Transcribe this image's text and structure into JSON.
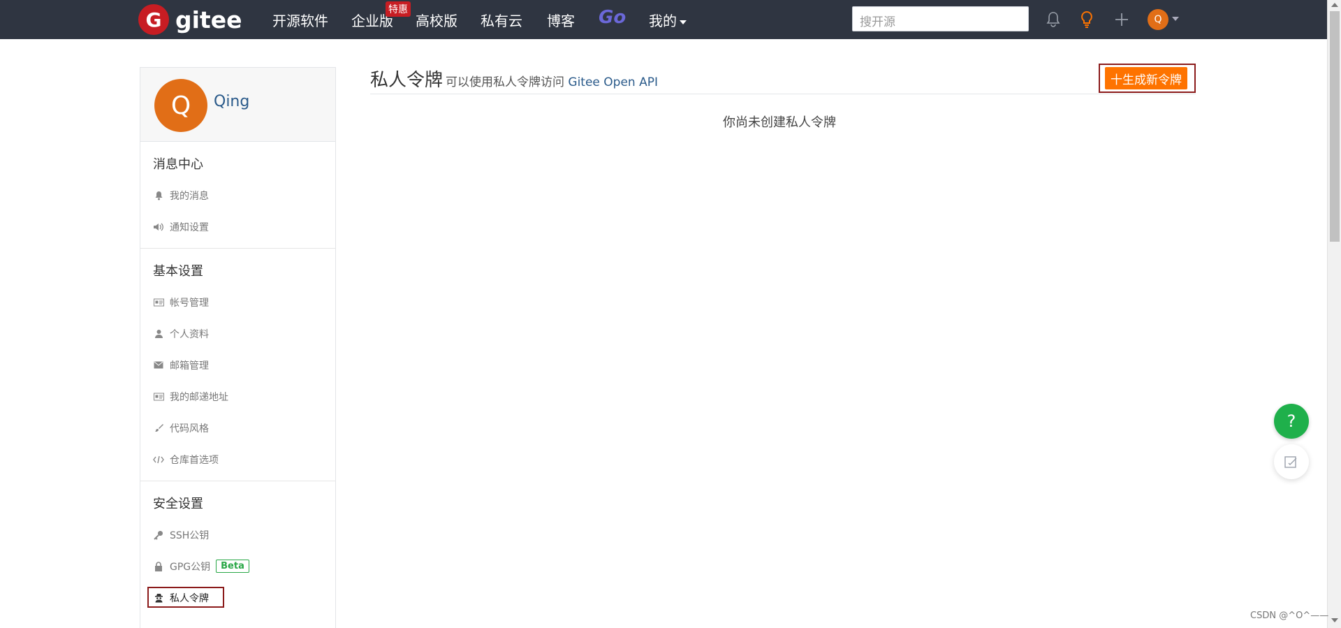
{
  "header": {
    "logo_letter": "G",
    "logo_text": "gitee",
    "nav": [
      "开源软件",
      "企业版",
      "高校版",
      "私有云",
      "博客"
    ],
    "badge": "特惠",
    "go_label": "Go",
    "mine_label": "我的",
    "search_placeholder": "搜开源",
    "avatar_letter": "Q"
  },
  "sidebar": {
    "avatar_letter": "Q",
    "username": "Qing",
    "sections": {
      "messages": {
        "title": "消息中心",
        "items": [
          "我的消息",
          "通知设置"
        ]
      },
      "basic": {
        "title": "基本设置",
        "items": [
          "帐号管理",
          "个人资料",
          "邮箱管理",
          "我的邮递地址",
          "代码风格",
          "仓库首选项"
        ]
      },
      "security": {
        "title": "安全设置",
        "items": [
          "SSH公钥",
          "GPG公钥",
          "私人令牌"
        ],
        "beta_label": "Beta"
      }
    }
  },
  "main": {
    "title": "私人令牌",
    "subtitle": "可以使用私人令牌访问",
    "api_link": "Gitee Open API",
    "generate_button": "十生成新令牌",
    "empty_text": "你尚未创建私人令牌"
  },
  "float": {
    "help": "?"
  },
  "watermark": "CSDN @^O^——",
  "colors": {
    "topbar": "#2f3541",
    "brand_red": "#c71d23",
    "orange": "#fe7300",
    "avatar": "#e16e17",
    "link": "#2a5a8a",
    "green": "#1fb04b"
  }
}
